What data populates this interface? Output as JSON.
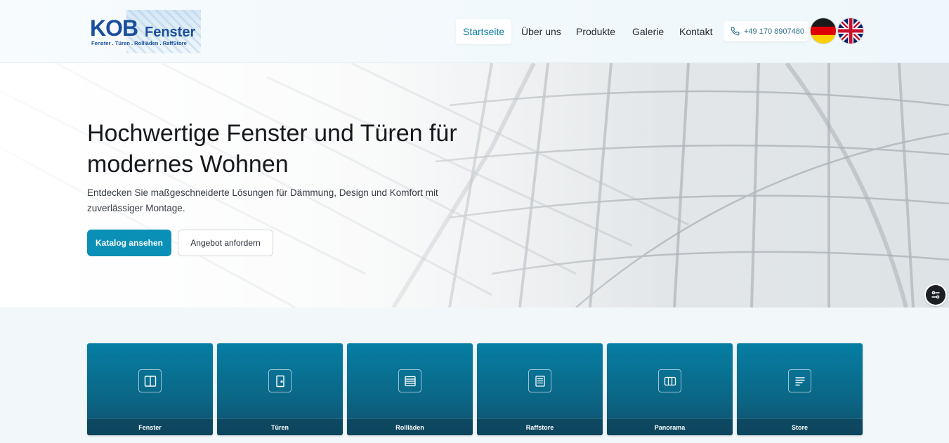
{
  "brand": {
    "name_part1": "KOB",
    "name_part2": "Fenster",
    "tagline": "Fenster . Türen . Rollläden . RaffStore",
    "color": "#1a4f9c"
  },
  "nav": {
    "items": [
      {
        "label": "Startseite",
        "active": true
      },
      {
        "label": "Über uns"
      },
      {
        "label": "Produkte"
      },
      {
        "label": "Galerie"
      },
      {
        "label": "Kontakt"
      }
    ],
    "phone": "+49 170 8907480",
    "languages": [
      "german-flag-icon",
      "uk-flag-icon"
    ]
  },
  "hero": {
    "title": "Hochwertige Fenster und Türen für modernes Wohnen",
    "subtitle": "Entdecken Sie maßgeschneiderte Lösungen für Dämmung, Design und Komfort mit zuverlässiger Montage.",
    "primary_button": "Katalog ansehen",
    "secondary_button": "Angebot anfordern",
    "accent": "#0a8fb6"
  },
  "categories": [
    {
      "label": "Fenster",
      "icon": "window-icon"
    },
    {
      "label": "Türen",
      "icon": "door-icon"
    },
    {
      "label": "Rollläden",
      "icon": "shutter-icon"
    },
    {
      "label": "Raffstore",
      "icon": "blind-icon"
    },
    {
      "label": "Panorama",
      "icon": "panorama-icon"
    },
    {
      "label": "Store",
      "icon": "store-icon"
    }
  ]
}
